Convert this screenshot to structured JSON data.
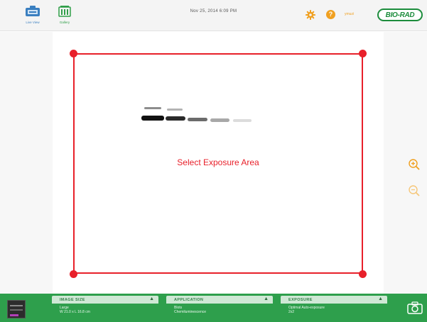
{
  "topbar": {
    "live_view_label": "Live View",
    "gallery_label": "Gallery",
    "datetime": "Nov 25, 2014  6:09 PM",
    "user_label": "ymuzi",
    "logo_text": "BIO-RAD"
  },
  "canvas": {
    "select_label": "Select Exposure Area"
  },
  "bottombar": {
    "image_size": {
      "title": "IMAGE SIZE",
      "line1": "Large",
      "line2": "W 21.0 x L 16.8 cm"
    },
    "application": {
      "title": "APPLICATION",
      "line1": "Blots",
      "line2": "Chemiluminescence"
    },
    "exposure": {
      "title": "EXPOSURE",
      "line1": "Optimal Auto-exposure",
      "line2": "2x2"
    }
  },
  "colors": {
    "brand_green": "#2e9f4c",
    "selection_red": "#e8202a",
    "accent_orange": "#f0a020",
    "live_view_blue": "#3a7fc0"
  },
  "icons": [
    "live-view-icon",
    "gallery-icon",
    "gear-icon",
    "help-icon",
    "zoom-in-icon",
    "zoom-out-icon",
    "camera-icon"
  ]
}
